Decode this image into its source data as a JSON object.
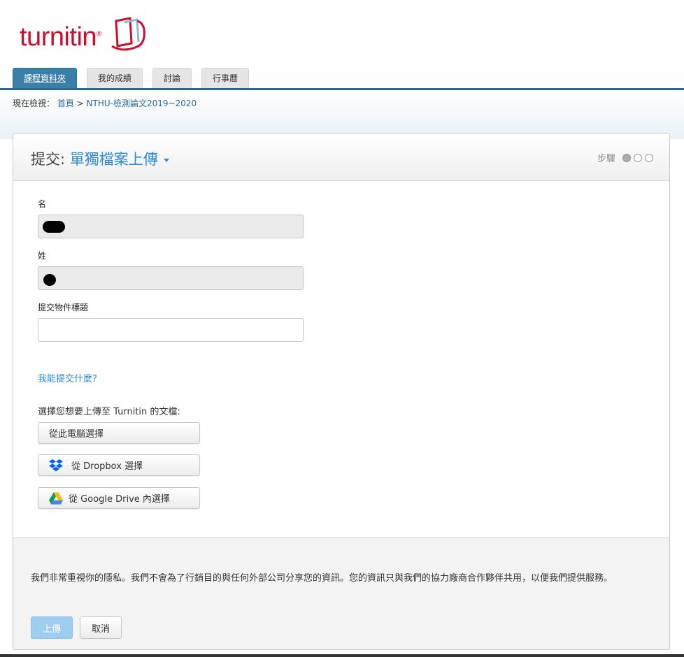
{
  "brand": {
    "name": "turnitin",
    "color": "#c8102e"
  },
  "tabs": [
    {
      "label": "課程資料夾",
      "active": true
    },
    {
      "label": "我的成績",
      "active": false
    },
    {
      "label": "討論",
      "active": false
    },
    {
      "label": "行事曆",
      "active": false
    }
  ],
  "breadcrumb": {
    "prefix": "現在檢視：",
    "home": "首頁",
    "separator": " > ",
    "current": "NTHU-檢測論文2019~2020"
  },
  "panel": {
    "title_prefix": "提交: ",
    "title_mode": "單獨檔案上傳",
    "steps_label": "步驟",
    "steps": {
      "current": 1,
      "total": 3
    }
  },
  "form": {
    "first_name_label": "名",
    "last_name_label": "姓",
    "title_label": "提交物件標題",
    "title_value": ""
  },
  "help_link": "我能提交什麼?",
  "choose_label": "選擇您想要上傳至 Turnitin 的文檔:",
  "buttons": {
    "computer": "從此電腦選擇",
    "dropbox": "從 Dropbox 選擇",
    "gdrive": "從 Google Drive 內選擇"
  },
  "privacy": "我們非常重視你的隱私。我們不會為了行銷目的與任何外部公司分享您的資訊。您的資訊只與我們的協力廠商合作夥伴共用，以便我們提供服務。",
  "actions": {
    "upload": "上傳",
    "cancel": "取消"
  },
  "colors": {
    "accent": "#2f8ad0",
    "tab_active": "#3a7fa8",
    "upload_disabled": "#9fcdf0"
  }
}
